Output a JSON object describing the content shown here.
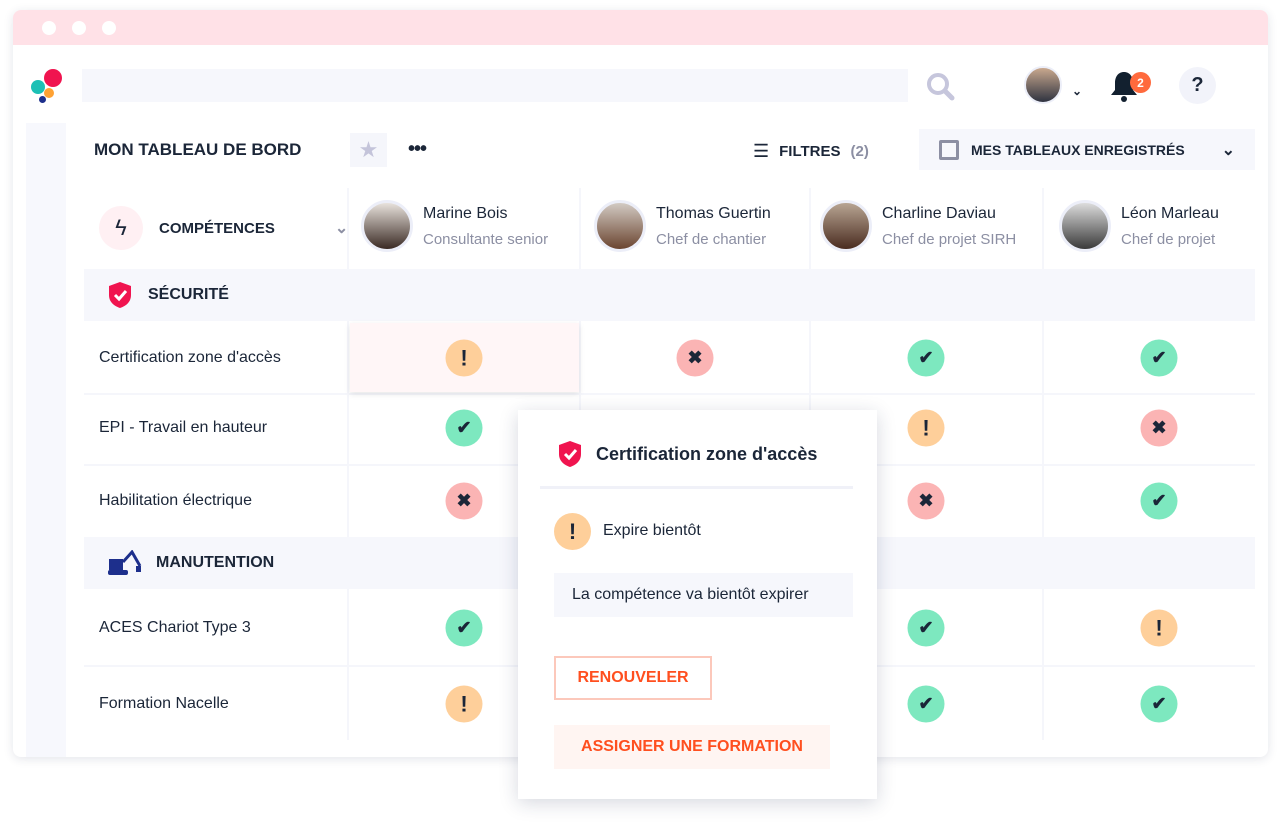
{
  "header": {
    "search_placeholder": "",
    "notifications_count": "2",
    "help_label": "?"
  },
  "toolbar": {
    "title": "MON TABLEAU DE BORD",
    "more_label": "•••",
    "filters_label": "FILTRES",
    "filters_count": "(2)",
    "saved_label": "MES TABLEAUX ENREGISTRÉS"
  },
  "table": {
    "skills_label": "COMPÉTENCES",
    "people": [
      {
        "name": "Marine Bois",
        "role": "Consultante senior"
      },
      {
        "name": "Thomas Guertin",
        "role": "Chef de chantier"
      },
      {
        "name": "Charline Daviau",
        "role": "Chef de projet SIRH"
      },
      {
        "name": "Léon Marleau",
        "role": "Chef de projet"
      }
    ],
    "groups": [
      {
        "label": "SÉCURITÉ",
        "rows": [
          {
            "label": "Certification zone d'accès",
            "status": [
              "warn",
              "no",
              "ok",
              "ok"
            ]
          },
          {
            "label": "EPI - Travail en hauteur",
            "status": [
              "ok",
              null,
              "warn",
              "no"
            ]
          },
          {
            "label": "Habilitation électrique",
            "status": [
              "no",
              null,
              "no",
              "ok"
            ]
          }
        ]
      },
      {
        "label": "MANUTENTION",
        "rows": [
          {
            "label": "ACES Chariot Type 3",
            "status": [
              "ok",
              null,
              "ok",
              "warn"
            ]
          },
          {
            "label": "Formation Nacelle",
            "status": [
              "warn",
              null,
              "ok",
              "ok"
            ]
          }
        ]
      }
    ]
  },
  "popup": {
    "title": "Certification zone d'accès",
    "status_label": "Expire bientôt",
    "message": "La compétence va bientôt expirer",
    "renew_label": "RENOUVELER",
    "assign_label": "ASSIGNER UNE FORMATION"
  },
  "colors": {
    "ok": "#7de8bf",
    "no": "#fbb4b4",
    "warn": "#fecf9a",
    "accent": "#ff4f1f",
    "brand": "#f0144f"
  }
}
